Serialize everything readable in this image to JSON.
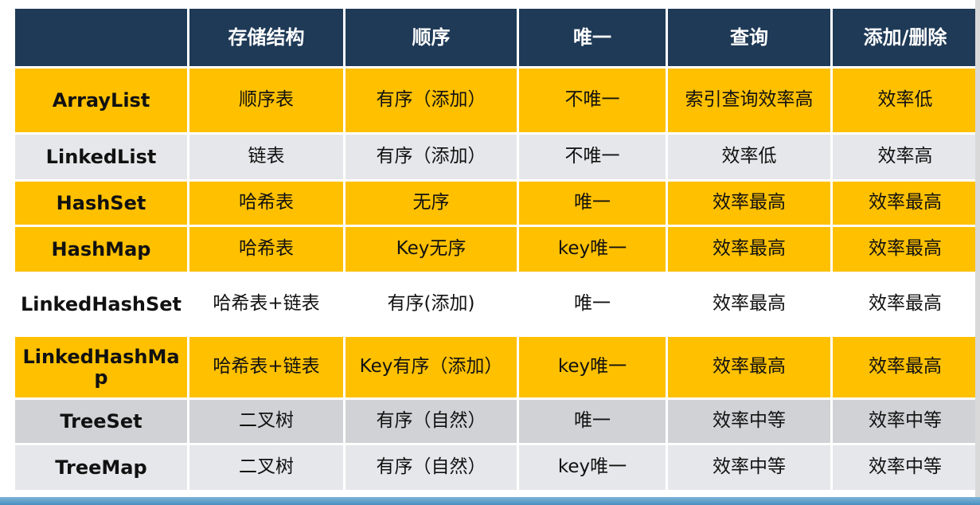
{
  "table": {
    "colors": {
      "header": "#1f3a57",
      "header_text": "#ffffff",
      "highlight": "#ffc000",
      "light": "#e6e7ea",
      "white": "#ffffff",
      "gray": "#d0d2d5"
    },
    "headers": [
      "",
      "存储结构",
      "顺序",
      "唯一",
      "查询",
      "添加/删除"
    ],
    "rows": [
      {
        "bg": "#ffc000",
        "cells": [
          "ArrayList",
          "顺序表",
          "有序（添加）",
          "不唯一",
          "索引查询效率高",
          "效率低"
        ]
      },
      {
        "bg": "#e6e7ea",
        "cells": [
          "LinkedList",
          "链表",
          "有序（添加）",
          "不唯一",
          "效率低",
          "效率高"
        ]
      },
      {
        "bg": "#ffc000",
        "cells": [
          "HashSet",
          "哈希表",
          "无序",
          "唯一",
          "效率最高",
          "效率最高"
        ]
      },
      {
        "bg": "#ffc000",
        "cells": [
          "HashMap",
          "哈希表",
          "Key无序",
          "key唯一",
          "效率最高",
          "效率最高"
        ]
      },
      {
        "bg": "#ffffff",
        "cells": [
          "LinkedHashSet",
          "哈希表+链表",
          "有序(添加)",
          "唯一",
          "效率最高",
          "效率最高"
        ]
      },
      {
        "bg": "#ffc000",
        "cells": [
          "LinkedHashMap",
          "哈希表+链表",
          "Key有序（添加）",
          "key唯一",
          "效率最高",
          "效率最高"
        ]
      },
      {
        "bg": "#d0d2d5",
        "cells": [
          "TreeSet",
          "二叉树",
          "有序（自然）",
          "唯一",
          "效率中等",
          "效率中等"
        ]
      },
      {
        "bg": "#e6e7ea",
        "cells": [
          "TreeMap",
          "二叉树",
          "有序（自然）",
          "key唯一",
          "效率中等",
          "效率中等"
        ]
      }
    ]
  }
}
